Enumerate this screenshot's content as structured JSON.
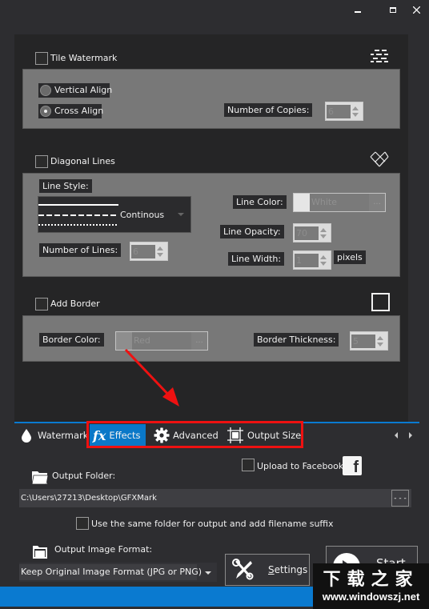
{
  "window": {
    "controls": {
      "minimize": "minimize",
      "maximize": "maximize",
      "close": "close"
    }
  },
  "tile_watermark": {
    "label": "Tile Watermark",
    "checked": false,
    "icon": "tile-pattern-icon",
    "align_options": [
      {
        "label": "Vertical Align",
        "selected": false
      },
      {
        "label": "Cross Align",
        "selected": true
      }
    ],
    "copies_label": "Number of Copies:",
    "copies_value": "6"
  },
  "diagonal_lines": {
    "label": "Diagonal Lines",
    "checked": false,
    "icon": "crosshatch-icon",
    "line_style_label": "Line Style:",
    "line_style_value": "Continous",
    "line_color_label": "Line Color:",
    "line_color_value": "White",
    "line_color_swatch": "#e6e6e6",
    "line_opacity_label": "Line Opacity:",
    "line_opacity_value": "70",
    "line_width_label": "Line Width:",
    "line_width_value": "1",
    "line_width_unit": "pixels",
    "num_lines_label": "Number of Lines:",
    "num_lines_value": "6"
  },
  "border": {
    "label": "Add Border",
    "checked": false,
    "icon": "square-outline-icon",
    "color_label": "Border Color:",
    "color_value": "Red",
    "color_swatch": "#8e8e8e",
    "thickness_label": "Border Thickness:",
    "thickness_value": "5"
  },
  "tabs": [
    {
      "label": "Watermark",
      "icon": "water-drop-icon",
      "active": false
    },
    {
      "label": "Effects",
      "icon": "fx-icon",
      "active": true
    },
    {
      "label": "Advanced",
      "icon": "gear-icon",
      "active": false
    },
    {
      "label": "Output Size",
      "icon": "crop-icon",
      "active": false
    }
  ],
  "output": {
    "folder_label": "Output Folder:",
    "folder_path": "C:\\Users\\27213\\Desktop\\GFXMark",
    "browse_label": "- - -",
    "upload_facebook_label": "Upload to Facebook",
    "same_folder_label": "Use the same folder for output and add filename suffix",
    "format_label": "Output Image Format:",
    "format_value": "Keep Original Image Format (JPG or PNG)",
    "settings_label": "Settings",
    "start_label": "Start"
  },
  "overlay_watermark": {
    "cn_text": "下载之家",
    "url": "www.windowszj.net"
  },
  "colors": {
    "accent": "#0a7ad0",
    "highlight": "#ee1111",
    "panel_bg": "#252526",
    "window_bg": "#2d2d30",
    "group_bg": "#787878"
  }
}
